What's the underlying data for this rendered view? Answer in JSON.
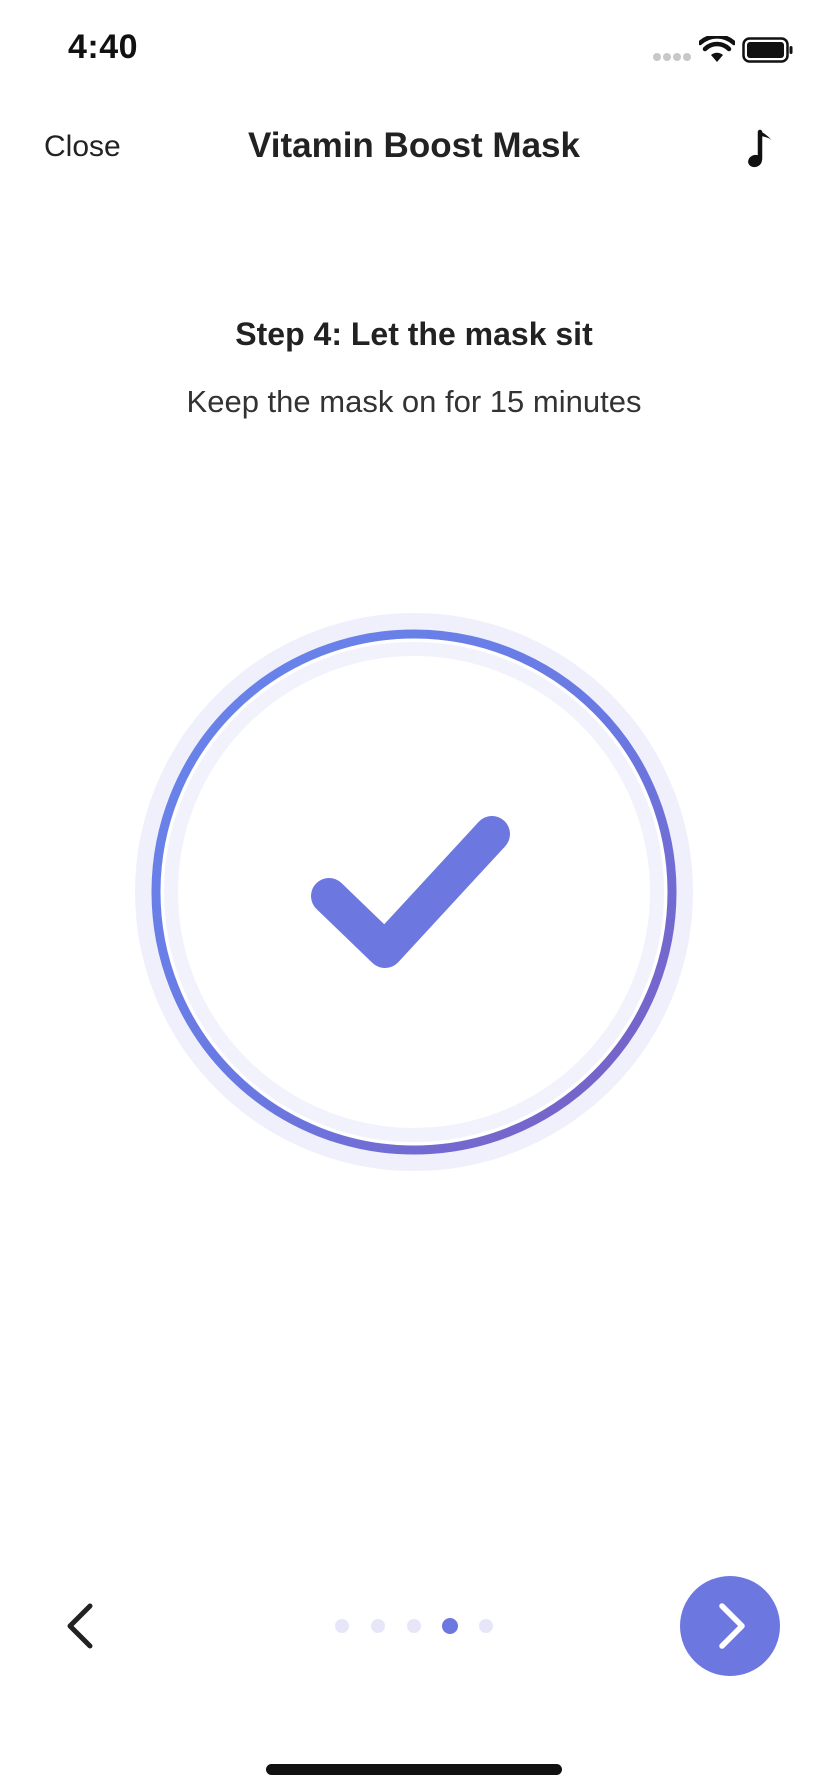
{
  "status_bar": {
    "time": "4:40",
    "icons": [
      "signal-dots-icon",
      "wifi-icon",
      "battery-icon"
    ]
  },
  "nav": {
    "close_label": "Close",
    "title": "Vitamin Boost Mask",
    "music_icon": "music-note-icon"
  },
  "step": {
    "title": "Step 4: Let the mask sit",
    "description": "Keep the mask on for 15 minutes",
    "completed": true,
    "progress": 1.0,
    "icon": "checkmark-icon"
  },
  "pager": {
    "total_pages": 5,
    "current_page": 4,
    "back_icon": "chevron-left-icon",
    "next_icon": "chevron-right-icon"
  },
  "colors": {
    "accent": "#6C78E0",
    "ring_start": "#6A82EA",
    "ring_end": "#7B5FC0",
    "ring_track": "#EFF0FB",
    "dot_inactive": "#E6E6F8",
    "text": "#222222"
  }
}
